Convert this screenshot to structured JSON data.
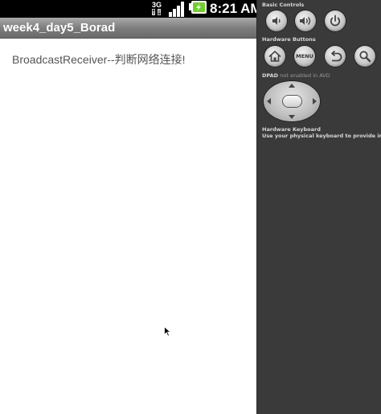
{
  "statusbar": {
    "network_type": "3G",
    "time": "8:21 AM"
  },
  "app": {
    "title": "week4_day5_Borad",
    "content_text": "BroadcastReceiver--判断网络连接!"
  },
  "panel": {
    "basic_controls_label": "Basic Controls",
    "hardware_buttons_label": "Hardware Buttons",
    "menu_button_label": "MENU",
    "dpad_label": "DPAD",
    "dpad_note": "not enabled in AVD",
    "hardware_keyboard_label": "Hardware Keyboard",
    "hardware_keyboard_desc": "Use your physical keyboard to provide input"
  },
  "icons": {
    "status": [
      "network-3g-icon",
      "signal-strength-icon",
      "battery-charging-icon"
    ],
    "basic_controls": [
      "volume-down-icon",
      "volume-up-icon",
      "power-icon"
    ],
    "hardware_buttons": [
      "home-icon",
      "menu-button",
      "back-icon",
      "search-icon"
    ],
    "cursor": "mouse-pointer-icon"
  },
  "colors": {
    "battery_accent": "#6fd02a",
    "title_bar": "#7b7b7b",
    "panel_background": "#3a3a3a"
  }
}
